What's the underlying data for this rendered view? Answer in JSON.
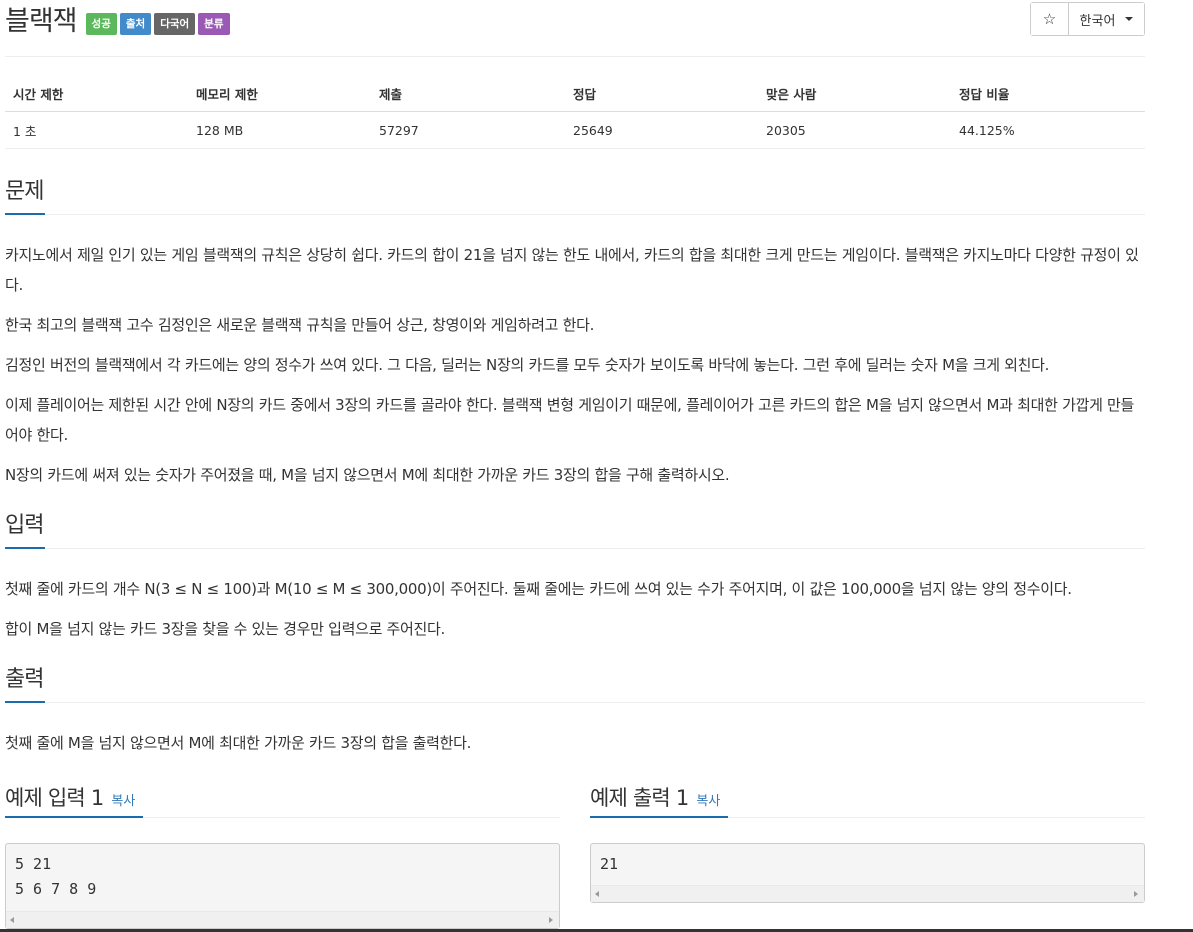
{
  "problem": {
    "title": "블랙잭",
    "labels": [
      {
        "text": "성공",
        "color": "#5cb85c"
      },
      {
        "text": "출처",
        "color": "#428bca"
      },
      {
        "text": "다국어",
        "color": "#666666"
      },
      {
        "text": "분류",
        "color": "#9b59b6"
      }
    ],
    "star_icon": "☆",
    "language_button": "한국어"
  },
  "info_table": {
    "headers": [
      "시간 제한",
      "메모리 제한",
      "제출",
      "정답",
      "맞은 사람",
      "정답 비율"
    ],
    "values": [
      "1 초",
      "128 MB",
      "57297",
      "25649",
      "20305",
      "44.125%"
    ]
  },
  "sections": {
    "problem_heading": "문제",
    "problem_paragraphs": [
      "카지노에서 제일 인기 있는 게임 블랙잭의 규칙은 상당히 쉽다. 카드의 합이 21을 넘지 않는 한도 내에서, 카드의 합을 최대한 크게 만드는 게임이다. 블랙잭은 카지노마다 다양한 규정이 있다.",
      "한국 최고의 블랙잭 고수 김정인은 새로운 블랙잭 규칙을 만들어 상근, 창영이와 게임하려고 한다.",
      "김정인 버전의 블랙잭에서 각 카드에는 양의 정수가 쓰여 있다. 그 다음, 딜러는 N장의 카드를 모두 숫자가 보이도록 바닥에 놓는다. 그런 후에 딜러는 숫자 M을 크게 외친다.",
      "이제 플레이어는 제한된 시간 안에 N장의 카드 중에서 3장의 카드를 골라야 한다. 블랙잭 변형 게임이기 때문에, 플레이어가 고른 카드의 합은 M을 넘지 않으면서 M과 최대한 가깝게 만들어야 한다.",
      "N장의 카드에 써져 있는 숫자가 주어졌을 때, M을 넘지 않으면서 M에 최대한 가까운 카드 3장의 합을 구해 출력하시오."
    ],
    "input_heading": "입력",
    "input_paragraphs": [
      "첫째 줄에 카드의 개수 N(3 ≤ N ≤ 100)과 M(10 ≤ M ≤ 300,000)이 주어진다. 둘째 줄에는 카드에 쓰여 있는 수가 주어지며, 이 값은 100,000을 넘지 않는 양의 정수이다.",
      "합이 M을 넘지 않는 카드 3장을 찾을 수 있는 경우만 입력으로 주어진다."
    ],
    "output_heading": "출력",
    "output_paragraphs": [
      "첫째 줄에 M을 넘지 않으면서 M에 최대한 가까운 카드 3장의 합을 출력한다."
    ]
  },
  "samples": {
    "input_title": "예제 입력 1",
    "output_title": "예제 출력 1",
    "copy_label": "복사",
    "input_lines": [
      "5 21",
      "5 6 7 8 9"
    ],
    "output_lines": [
      "21"
    ]
  },
  "colors": {
    "accent_underline": "#1a6cad",
    "link": "#337ab7"
  }
}
